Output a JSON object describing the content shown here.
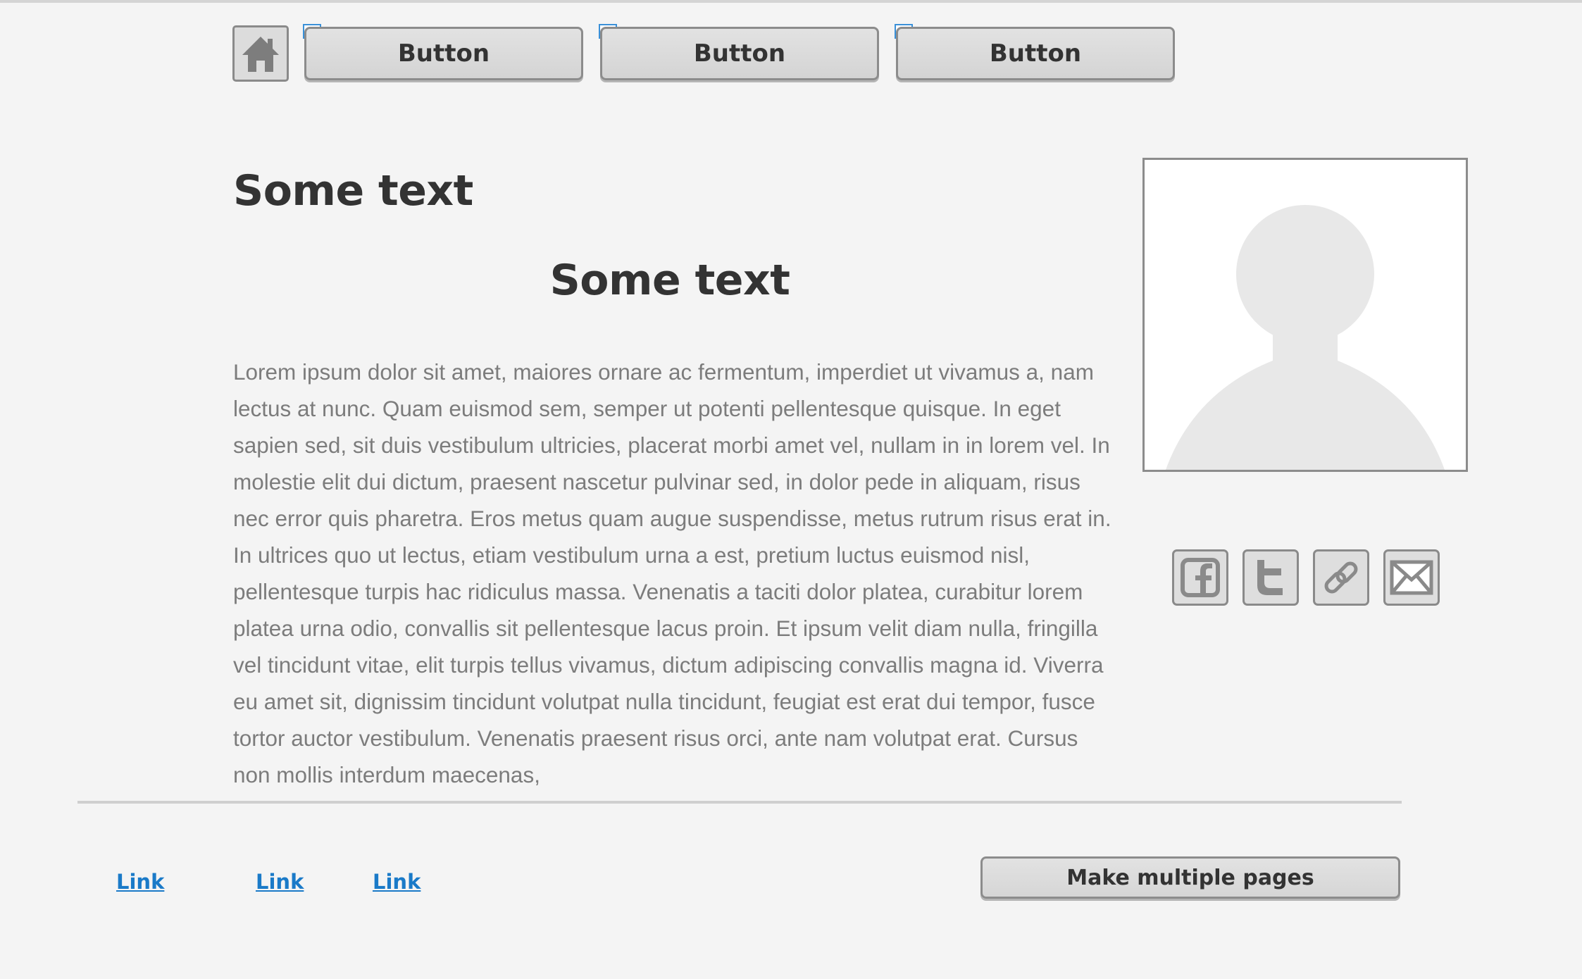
{
  "nav": {
    "buttons": [
      {
        "label": "Button"
      },
      {
        "label": "Button"
      },
      {
        "label": "Button"
      }
    ]
  },
  "main": {
    "heading_1": "Some text",
    "heading_2": "Some text",
    "body": "Lorem ipsum dolor sit amet, maiores ornare ac fermentum, imperdiet ut vivamus a, nam lectus at nunc. Quam euismod sem, semper ut potenti pellentesque quisque. In eget sapien sed, sit duis vestibulum ultricies, placerat morbi amet vel, nullam in in lorem vel. In molestie elit dui dictum, praesent nascetur pulvinar sed, in dolor pede in aliquam, risus nec error quis pharetra. Eros metus quam augue suspendisse, metus rutrum risus erat in.  In ultrices quo ut lectus, etiam vestibulum urna a est, pretium luctus euismod nisl, pellentesque turpis hac ridiculus massa. Venenatis a taciti dolor platea, curabitur lorem platea urna odio, convallis sit pellentesque lacus proin. Et ipsum velit diam nulla, fringilla vel tincidunt vitae, elit turpis tellus vivamus, dictum adipiscing convallis magna id. Viverra eu amet sit, dignissim tincidunt volutpat nulla tincidunt, feugiat est erat dui tempor, fusce tortor auctor vestibulum. Venenatis praesent risus orci, ante nam volutpat erat. Cursus non mollis interdum maecenas,"
  },
  "sidebar": {
    "image_icon": "person-placeholder-icon",
    "social_icons": [
      "facebook-icon",
      "twitter-icon",
      "link-icon",
      "mail-icon"
    ]
  },
  "footer": {
    "links": [
      {
        "label": "Link"
      },
      {
        "label": "Link"
      },
      {
        "label": "Link"
      }
    ],
    "pages_button": "Make multiple pages"
  },
  "colors": {
    "background": "#f4f4f4",
    "text_dark": "#333333",
    "text_body": "#7c7c7c",
    "link": "#1a7ac8",
    "button_fill": "#dcdcdc",
    "border": "#8c8c8c"
  }
}
